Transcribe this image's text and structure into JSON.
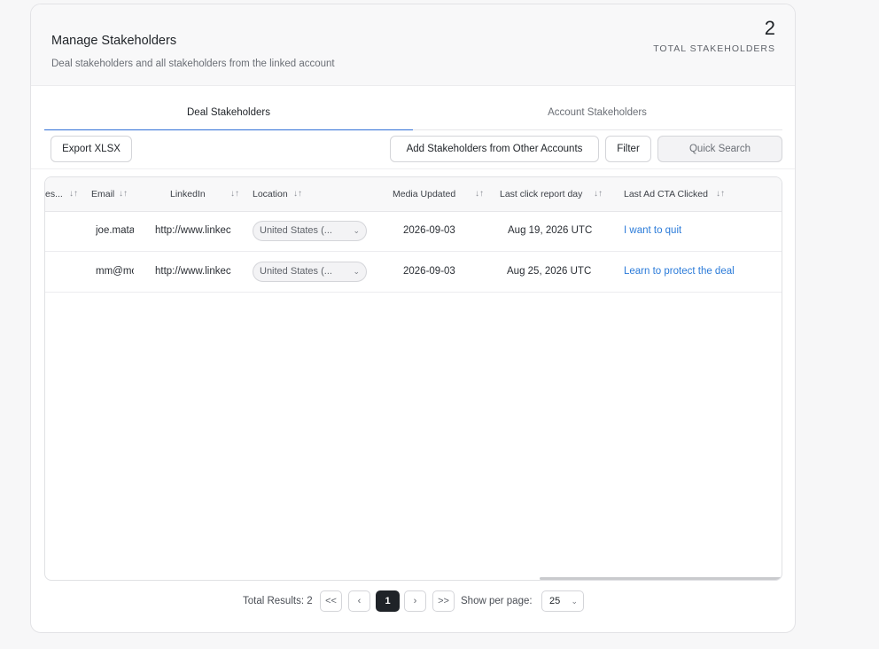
{
  "header": {
    "title": "Manage Stakeholders",
    "subtitle": "Deal stakeholders and all stakeholders from the linked account",
    "count": "2",
    "count_label": "TOTAL STAKEHOLDERS"
  },
  "tabs": [
    {
      "label": "Deal Stakeholders",
      "active": true
    },
    {
      "label": "Account Stakeholders",
      "active": false
    }
  ],
  "toolbar": {
    "export_label": "Export XLSX",
    "add_label": "Add Stakeholders from Other Accounts",
    "filter_label": "Filter",
    "search_placeholder": "Quick Search"
  },
  "table": {
    "columns": [
      "es...",
      "Email",
      "LinkedIn",
      "Location",
      "Media Updated",
      "Last click report day",
      "Last Ad CTA Clicked"
    ],
    "rows": [
      {
        "email": "joe.mata",
        "linkedin": "http://www.linkec",
        "location": "United States (...",
        "media_updated": "2026-09-03",
        "last_click": "Aug 19, 2026 UTC",
        "last_cta": "I want to quit"
      },
      {
        "email": "mm@mc",
        "linkedin": "http://www.linkec",
        "location": "United States (...",
        "media_updated": "2026-09-03",
        "last_click": "Aug 25, 2026 UTC",
        "last_cta": "Learn to protect the deal"
      }
    ]
  },
  "pagination": {
    "total_label": "Total Results: 2",
    "current_page": "1",
    "per_page_label": "Show per page:",
    "per_page_value": "25"
  },
  "icons": {
    "sort": "↓↑",
    "first": "<<",
    "prev": "‹",
    "next": "›",
    "last": ">>",
    "chevron": "⌄"
  },
  "colors": {
    "accent": "#2f6fd6",
    "link": "#2b7bd9",
    "active_page": "#1f2328"
  }
}
